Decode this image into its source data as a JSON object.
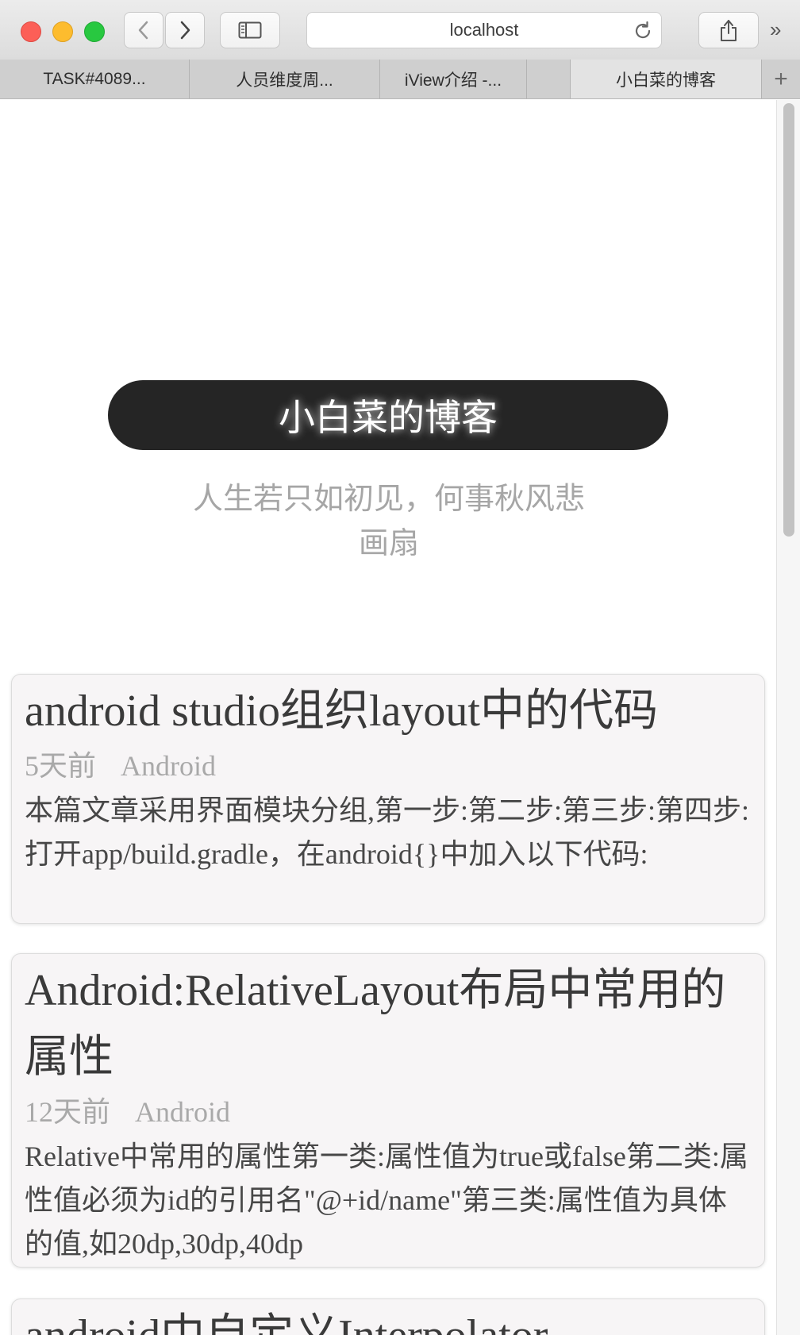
{
  "browser": {
    "address": "localhost",
    "tabs": [
      {
        "label": "TASK#4089..."
      },
      {
        "label": "人员维度周..."
      },
      {
        "label": "iView介绍 -..."
      },
      {
        "label": ""
      },
      {
        "label": "小白菜的博客"
      }
    ],
    "new_tab_label": "+",
    "overflow_label": "»"
  },
  "blog": {
    "title": "小白菜的博客",
    "subtitle": "人生若只如初见，何事秋风悲画扇",
    "posts": [
      {
        "title": "android studio组织layout中的代码",
        "time": "5天前",
        "category": "Android",
        "summary": "本篇文章采用界面模块分组,第一步:第二步:第三步:第四步:打开app/build.gradle，在android{}中加入以下代码:"
      },
      {
        "title": "Android:RelativeLayout布局中常用的属性",
        "time": "12天前",
        "category": "Android",
        "summary": "Relative中常用的属性第一类:属性值为true或false第二类:属性值必须为id的引用名\"@+id/name\"第三类:属性值为具体的值,如20dp,30dp,40dp"
      },
      {
        "title": "android中自定义Interpolator"
      }
    ]
  }
}
